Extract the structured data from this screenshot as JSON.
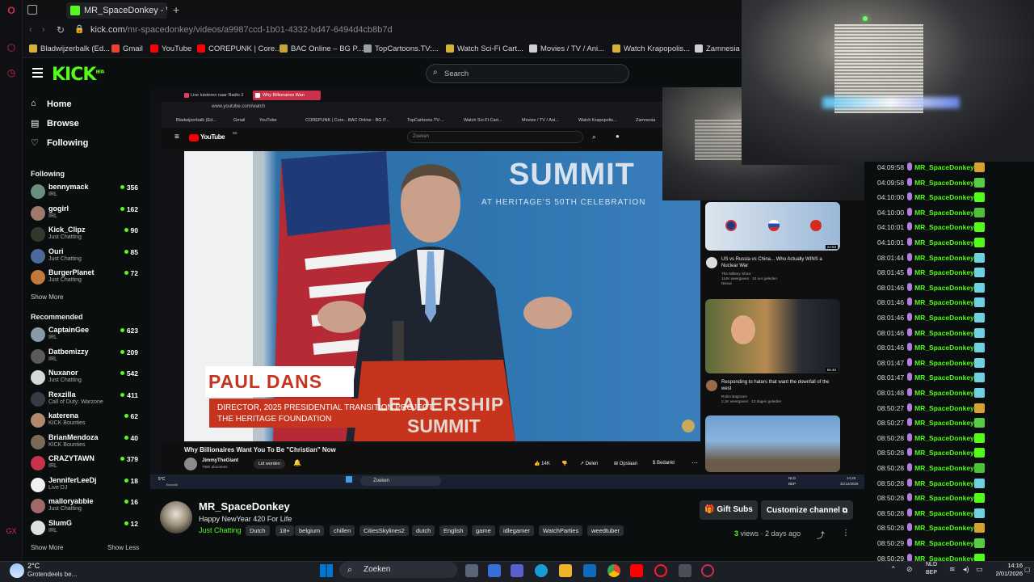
{
  "browser": {
    "active_tab_title": "MR_SpaceDonkey - W",
    "url_host": "kick.com",
    "url_path": "/mr-spacedonkey/videos/a9987ccd-1b01-4332-bd47-6494d4cb8b7d",
    "bookmarks": [
      {
        "label": "Bladwijzerbalk (Ed...",
        "color": "#d7b03a"
      },
      {
        "label": "Gmail",
        "color": "#ea4335"
      },
      {
        "label": "YouTube",
        "color": "#ff0000"
      },
      {
        "label": "COREPUNK | Core...",
        "color": "#ff0000"
      },
      {
        "label": "BAC Online – BG P...",
        "color": "#c9a23a"
      },
      {
        "label": "TopCartoons.TV:...",
        "color": "#9aa0a6"
      },
      {
        "label": "Watch Sci-Fi Cart...",
        "color": "#d7b03a"
      },
      {
        "label": "Movies / TV / Ani...",
        "color": "#cfcfcf"
      },
      {
        "label": "Watch Krapopolis...",
        "color": "#d7b03a"
      },
      {
        "label": "Zamnesia",
        "color": "#cfcfcf"
      }
    ]
  },
  "kick": {
    "logo": "KICK",
    "logo_badge": "BETA",
    "search_placeholder": "Search",
    "nav": [
      {
        "label": "Home",
        "icon": "home-icon"
      },
      {
        "label": "Browse",
        "icon": "browse-icon"
      },
      {
        "label": "Following",
        "icon": "heart-icon"
      }
    ],
    "following_heading": "Following",
    "following": [
      {
        "name": "bennymack",
        "category": "IRL",
        "viewers": "356",
        "color": "#6a8f7d"
      },
      {
        "name": "gogirl",
        "category": "IRL",
        "viewers": "162",
        "color": "#a07a6a"
      },
      {
        "name": "Kick_Clipz",
        "category": "Just Chatting",
        "viewers": "90",
        "color": "#2f3a2c"
      },
      {
        "name": "Ouri",
        "category": "Just Chatting",
        "viewers": "85",
        "color": "#4b6b9a"
      },
      {
        "name": "BurgerPlanet",
        "category": "Just Chatting",
        "viewers": "72",
        "color": "#c27a3a"
      }
    ],
    "show_more": "Show More",
    "recommended_heading": "Recommended",
    "recommended": [
      {
        "name": "CaptainGee",
        "category": "IRL",
        "viewers": "623",
        "color": "#8a9aa6"
      },
      {
        "name": "Datbemizzy",
        "category": "IRL",
        "viewers": "209",
        "color": "#5a5a5a"
      },
      {
        "name": "Nuxanor",
        "category": "Just Chatting",
        "viewers": "542",
        "color": "#d8d8d8"
      },
      {
        "name": "Rexzilla",
        "category": "Call of Duty: Warzone",
        "viewers": "411",
        "color": "#3a3a44"
      },
      {
        "name": "katerena",
        "category": "KICK Bounties",
        "viewers": "62",
        "color": "#b08a6a"
      },
      {
        "name": "BrianMendoza",
        "category": "KICK Bounties",
        "viewers": "40",
        "color": "#7a6a5a"
      },
      {
        "name": "CRAZYTAWN",
        "category": "IRL",
        "viewers": "379",
        "color": "#c8324a"
      },
      {
        "name": "JenniferLeeDj",
        "category": "Live DJ",
        "viewers": "18",
        "color": "#f0f0f0"
      },
      {
        "name": "malloryabbie",
        "category": "Just Chatting",
        "viewers": "16",
        "color": "#a06a6a"
      },
      {
        "name": "SlumG",
        "category": "IRL",
        "viewers": "12",
        "color": "#e0e0e0"
      }
    ],
    "show_less": "Show Less"
  },
  "inner": {
    "tab1": "Live luisteren naar Radio 2",
    "tab2": "Why Billionaires Wan",
    "url": "www.youtube.com/watch",
    "bookmarks": [
      "Bladwijzerbalk (Ed...",
      "Gmail",
      "YouTube",
      "COREPUNK | Core...",
      "BAC Online - BG P...",
      "TopCartoons.TV:...",
      "Watch Sci-Fi Cart...",
      "Movies / TV / Ani...",
      "Watch Krapopolis...",
      "Zamnesia"
    ],
    "yt_logo": "YouTube",
    "yt_region": "BE",
    "yt_search": "Zoeken",
    "video_summit": "SUMMIT",
    "video_summit_sub": "AT HERITAGE'S 50TH CELEBRATION",
    "lower_name": "PAUL DANS",
    "lower_title_1": "DIRECTOR, 2025 PRESIDENTIAL TRANSITION PROJECT,",
    "lower_title_2": "THE HERITAGE FOUNDATION",
    "podium_1": "LEADERSHIP",
    "podium_2": "SUMMIT",
    "video_title": "Why Billionaires Want You To Be \"Christian\" Now",
    "channel": "JimmyTheGiant",
    "subs": "798K abonnees",
    "join": "Lid worden",
    "likes": "14K",
    "share": "Delen",
    "save": "Opslaan",
    "thanks": "Bedankt",
    "rec1_title": "US vs Russia vs China... Who Actually WINS a Nuclear War",
    "rec1_channel": "The Military Show",
    "rec1_meta": "114K weergaven · 10 uur geleden",
    "rec1_badge": "Nieuw",
    "rec1_duration": "24:53",
    "rec2_title": "Responding to haters that want the downfall of the west",
    "rec2_channel": "Robin Bagroom",
    "rec2_meta": "2,1K weergaven · 13 dagen geleden",
    "rec2_duration": "56:40",
    "taskbar_weather": "5°C",
    "taskbar_weather_sub": "Bewolkt",
    "taskbar_search": "Zoeken",
    "lang_1": "NLD",
    "lang_2": "BEP",
    "time": "14:26",
    "date": "31/12/2025"
  },
  "chat": [
    {
      "time": "04:09:58",
      "user": "MR_SpaceDonkey:",
      "emote": "#d8a030"
    },
    {
      "time": "04:09:58",
      "user": "MR_SpaceDonkey:",
      "emote": "#55cc44"
    },
    {
      "time": "04:10:00",
      "user": "MR_SpaceDonkey:",
      "emote": "#53fc18"
    },
    {
      "time": "04:10:00",
      "user": "MR_SpaceDonkey:",
      "emote": "#4fbf3a"
    },
    {
      "time": "04:10:01",
      "user": "MR_SpaceDonkey:",
      "emote": "#53fc18"
    },
    {
      "time": "04:10:01",
      "user": "MR_SpaceDonkey:",
      "emote": "#53fc18"
    },
    {
      "time": "08:01:44",
      "user": "MR_SpaceDonkey:",
      "emote": "#6fd0e0"
    },
    {
      "time": "08:01:45",
      "user": "MR_SpaceDonkey:",
      "emote": "#6fd0e0"
    },
    {
      "time": "08:01:46",
      "user": "MR_SpaceDonkey:",
      "emote": "#6fd0e0"
    },
    {
      "time": "08:01:46",
      "user": "MR_SpaceDonkey:",
      "emote": "#6fd0e0"
    },
    {
      "time": "08:01:46",
      "user": "MR_SpaceDonkey:",
      "emote": "#6fd0e0"
    },
    {
      "time": "08:01:46",
      "user": "MR_SpaceDonkey:",
      "emote": "#6fd0e0"
    },
    {
      "time": "08:01:46",
      "user": "MR_SpaceDonkey:",
      "emote": "#6fd0e0"
    },
    {
      "time": "08:01:47",
      "user": "MR_SpaceDonkey:",
      "emote": "#6fd0e0"
    },
    {
      "time": "08:01:47",
      "user": "MR_SpaceDonkey:",
      "emote": "#6fd0e0"
    },
    {
      "time": "08:01:48",
      "user": "MR_SpaceDonkey:",
      "emote": "#6fd0e0"
    },
    {
      "time": "08:50:27",
      "user": "MR_SpaceDonkey:",
      "emote": "#d8a030"
    },
    {
      "time": "08:50:27",
      "user": "MR_SpaceDonkey:",
      "emote": "#55cc44"
    },
    {
      "time": "08:50:28",
      "user": "MR_SpaceDonkey:",
      "emote": "#53fc18"
    },
    {
      "time": "08:50:28",
      "user": "MR_SpaceDonkey:",
      "emote": "#53fc18"
    },
    {
      "time": "08:50:28",
      "user": "MR_SpaceDonkey:",
      "emote": "#4fbf3a"
    },
    {
      "time": "08:50:28",
      "user": "MR_SpaceDonkey:",
      "emote": "#6fd0e0"
    },
    {
      "time": "08:50:28",
      "user": "MR_SpaceDonkey:",
      "emote": "#53fc18"
    },
    {
      "time": "08:50:28",
      "user": "MR_SpaceDonkey:",
      "emote": "#6fd0e0"
    },
    {
      "time": "08:50:28",
      "user": "MR_SpaceDonkey:",
      "emote": "#d8a030"
    },
    {
      "time": "08:50:29",
      "user": "MR_SpaceDonkey:",
      "emote": "#55cc44"
    },
    {
      "time": "08:50:29",
      "user": "MR_SpaceDonkey:",
      "emote": "#53fc18"
    }
  ],
  "channel": {
    "name": "MR_SpaceDonkey",
    "title": "Happy NewYear 420 For Life",
    "category": "Just Chatting",
    "tags": [
      "Dutch",
      "18+",
      "belgium",
      "chillen",
      "CitiesSkylines2",
      "dutch",
      "English",
      "game",
      "idlegamer",
      "WatchParties",
      "weedtuber"
    ],
    "gift_subs": "Gift Subs",
    "customize": "Customize channel",
    "views_count": "3",
    "views_label": "views",
    "ago": "2 days ago"
  },
  "taskbar": {
    "weather_temp": "2°C",
    "weather_desc": "Grotendeels be...",
    "search": "Zoeken",
    "lang_1": "NLD",
    "lang_2": "BEP",
    "time": "14:16",
    "date": "2/01/2026"
  },
  "colors": {
    "kick_green": "#53fc18",
    "opera_red": "#c8324a",
    "yt_red": "#ff0000"
  }
}
